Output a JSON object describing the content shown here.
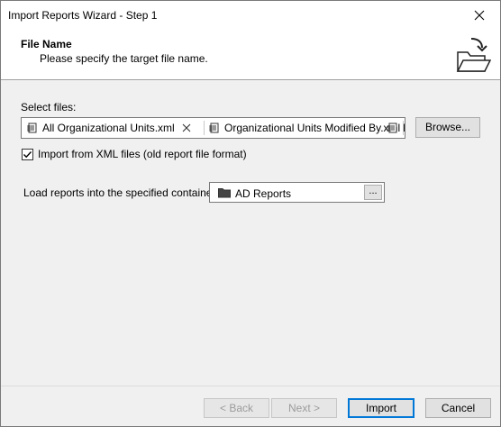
{
  "window": {
    "title": "Import Reports Wizard - Step 1"
  },
  "header": {
    "title": "File Name",
    "subtitle": "Please specify the target file name."
  },
  "files": {
    "label": "Select files:",
    "items": [
      {
        "name": "All Organizational Units.xml"
      },
      {
        "name": "Organizational Units Modified By.xml"
      },
      {
        "name": "I"
      }
    ],
    "browse_label": "Browse..."
  },
  "xml_option": {
    "label": "Import from XML files (old report file format)",
    "checked": true
  },
  "container": {
    "label": "Load reports into the specified container:",
    "value": "AD Reports",
    "ellipsis_label": "..."
  },
  "footer": {
    "back_label": "< Back",
    "next_label": "Next >",
    "import_label": "Import",
    "cancel_label": "Cancel"
  }
}
